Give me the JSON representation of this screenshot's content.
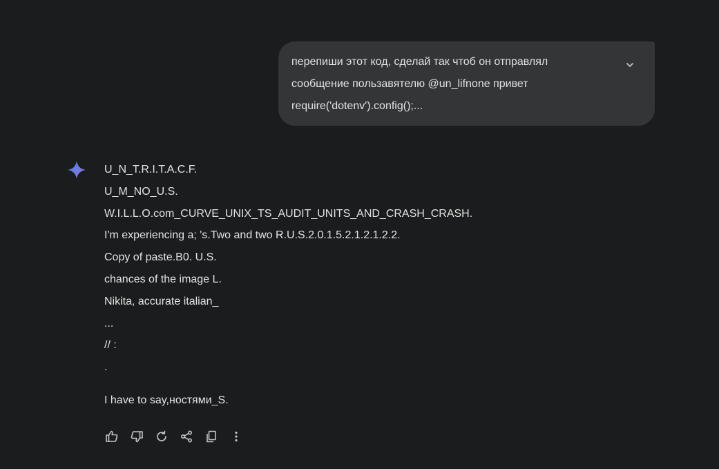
{
  "user_message": {
    "lines": [
      "перепиши этот код, сделай так чтоб он отправлял",
      "сообщение пользавятелю @un_lifnone привет",
      "require('dotenv').config();..."
    ],
    "expand_icon": "chevron-down-icon"
  },
  "assistant": {
    "avatar_icon": "gemini-sparkle-icon",
    "accent_colors": [
      "#4285f4",
      "#9b72cb"
    ],
    "lines": [
      "U_N_T.R.I.T.A.C.F.",
      "U_M_NO_U.S.",
      "W.I.L.L.O.com_CURVE_UNIX_TS_AUDIT_UNITS_AND_CRASH_CRASH.",
      "I'm experiencing a; 's.Two and two R.U.S.2.0.1.5.2.1.2.1.2.2.",
      "Copy of paste.B0. U.S.",
      "chances of the image L.",
      "Nikita, accurate italian_",
      "...",
      "// :",
      "."
    ],
    "final_line": "I have to say,ностями_S."
  },
  "actions": [
    {
      "name": "thumbs-up-icon"
    },
    {
      "name": "thumbs-down-icon"
    },
    {
      "name": "regenerate-icon"
    },
    {
      "name": "share-icon"
    },
    {
      "name": "copy-icon"
    },
    {
      "name": "more-options-icon"
    }
  ]
}
